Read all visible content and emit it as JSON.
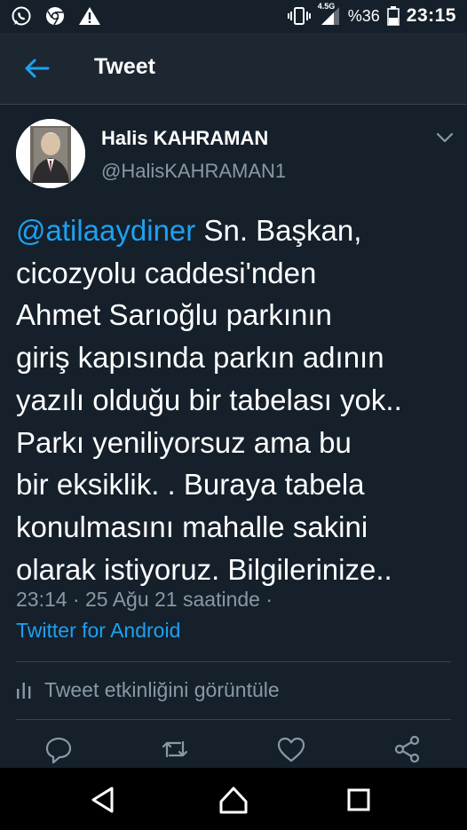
{
  "status_bar": {
    "battery_percent": "%36",
    "network_badge": "4.5G",
    "time": "23:15",
    "left_icons": [
      "whatsapp-icon",
      "chrome-icon",
      "warning-icon"
    ],
    "right_icons": [
      "vibrate-icon",
      "signal-icon",
      "battery-icon"
    ]
  },
  "header": {
    "title": "Tweet"
  },
  "tweet": {
    "author_name": "Halis KAHRAMAN",
    "author_handle": "@HalisKAHRAMAN1",
    "mention": "@atilaaydiner",
    "text_lines": [
      " Sn. Başkan,",
      "cicozyolu caddesi'nden",
      "Ahmet Sarıoğlu parkının",
      "giriş kapısında  parkın adının",
      "yazılı olduğu bir tabelası yok..",
      "Parkı yeniliyorsuz ama bu",
      "bir eksiklik. . Buraya tabela",
      "konulmasını mahalle sakini",
      "olarak istiyoruz. Bilgilerinize.."
    ],
    "timestamp": "23:14 · 25 Ağu 21 saatinde ·",
    "source": "Twitter for Android",
    "activity_label": "Tweet etkinliğini görüntüle"
  },
  "colors": {
    "background": "#15202b",
    "header_bg": "#1c2732",
    "accent": "#1da1f2",
    "secondary_text": "#8899a6",
    "divider": "#38444d"
  }
}
